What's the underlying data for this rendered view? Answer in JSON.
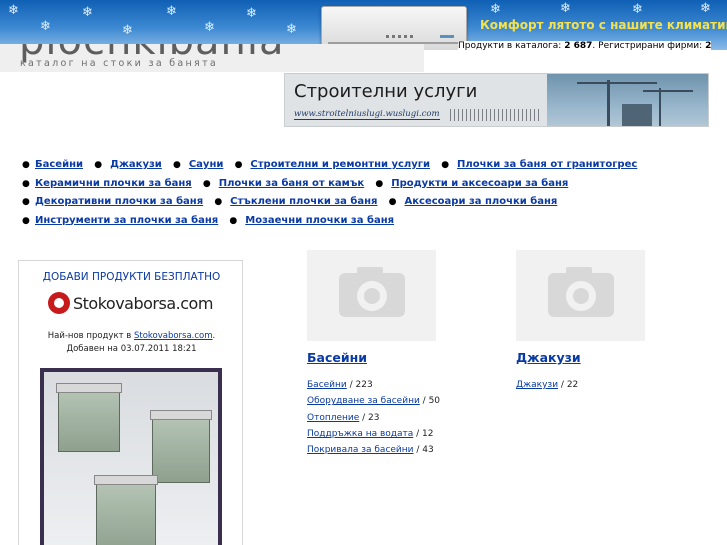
{
  "banner": {
    "text": "Комфорт лятото с нашите климатици"
  },
  "logo": {
    "title": "plochkibania",
    "subtitle": "каталог на стоки за банята"
  },
  "stats": {
    "products_label": "Продукти в каталога:",
    "products_count": "2 687",
    "firms_label": "Регистрирани фирми:",
    "firms_count": "2"
  },
  "ad": {
    "title": "Строителни услуги",
    "url": "www.stroitelniuslugi.wuslugi.com"
  },
  "nav": {
    "row1": [
      "Басейни",
      "Джакузи",
      "Сауни",
      "Строителни и ремонтни услуги",
      "Плочки за баня от гранитогрес"
    ],
    "row2": [
      "Керамични плочки за баня",
      "Плочки за баня от камък",
      "Продукти и аксесоари за баня"
    ],
    "row3": [
      "Декоративни плочки за баня",
      "Стъклени плочки за баня",
      "Аксесоари за плочки баня"
    ],
    "row4": [
      "Инструменти за плочки за баня",
      "Мозаечни плочки за баня"
    ]
  },
  "sidebox": {
    "add_title": "ДОБАВИ ПРОДУКТИ БЕЗПЛАТНО",
    "brand": "Stokovaborsa.com",
    "latest_prefix": "Най-нов продукт в",
    "latest_link": "Stokovaborsa.com",
    "latest_suffix": ".",
    "added": "Добавен на 03.07.2011 18:21"
  },
  "categories": [
    {
      "title": "Басейни",
      "items": [
        {
          "name": "Басейни",
          "count": " / 223"
        },
        {
          "name": "Оборудване за басейни",
          "count": " / 50"
        },
        {
          "name": "Отопление",
          "count": " / 23"
        },
        {
          "name": "Поддръжка на водата",
          "count": " / 12"
        },
        {
          "name": "Покривала за басейни",
          "count": " / 43"
        }
      ]
    },
    {
      "title": "Джакузи",
      "items": [
        {
          "name": "Джакузи",
          "count": " / 22"
        }
      ]
    }
  ],
  "colors": {
    "link": "#0a3aa3",
    "banner_text": "#f5e24a",
    "banner_bg": "#1a66b8"
  }
}
